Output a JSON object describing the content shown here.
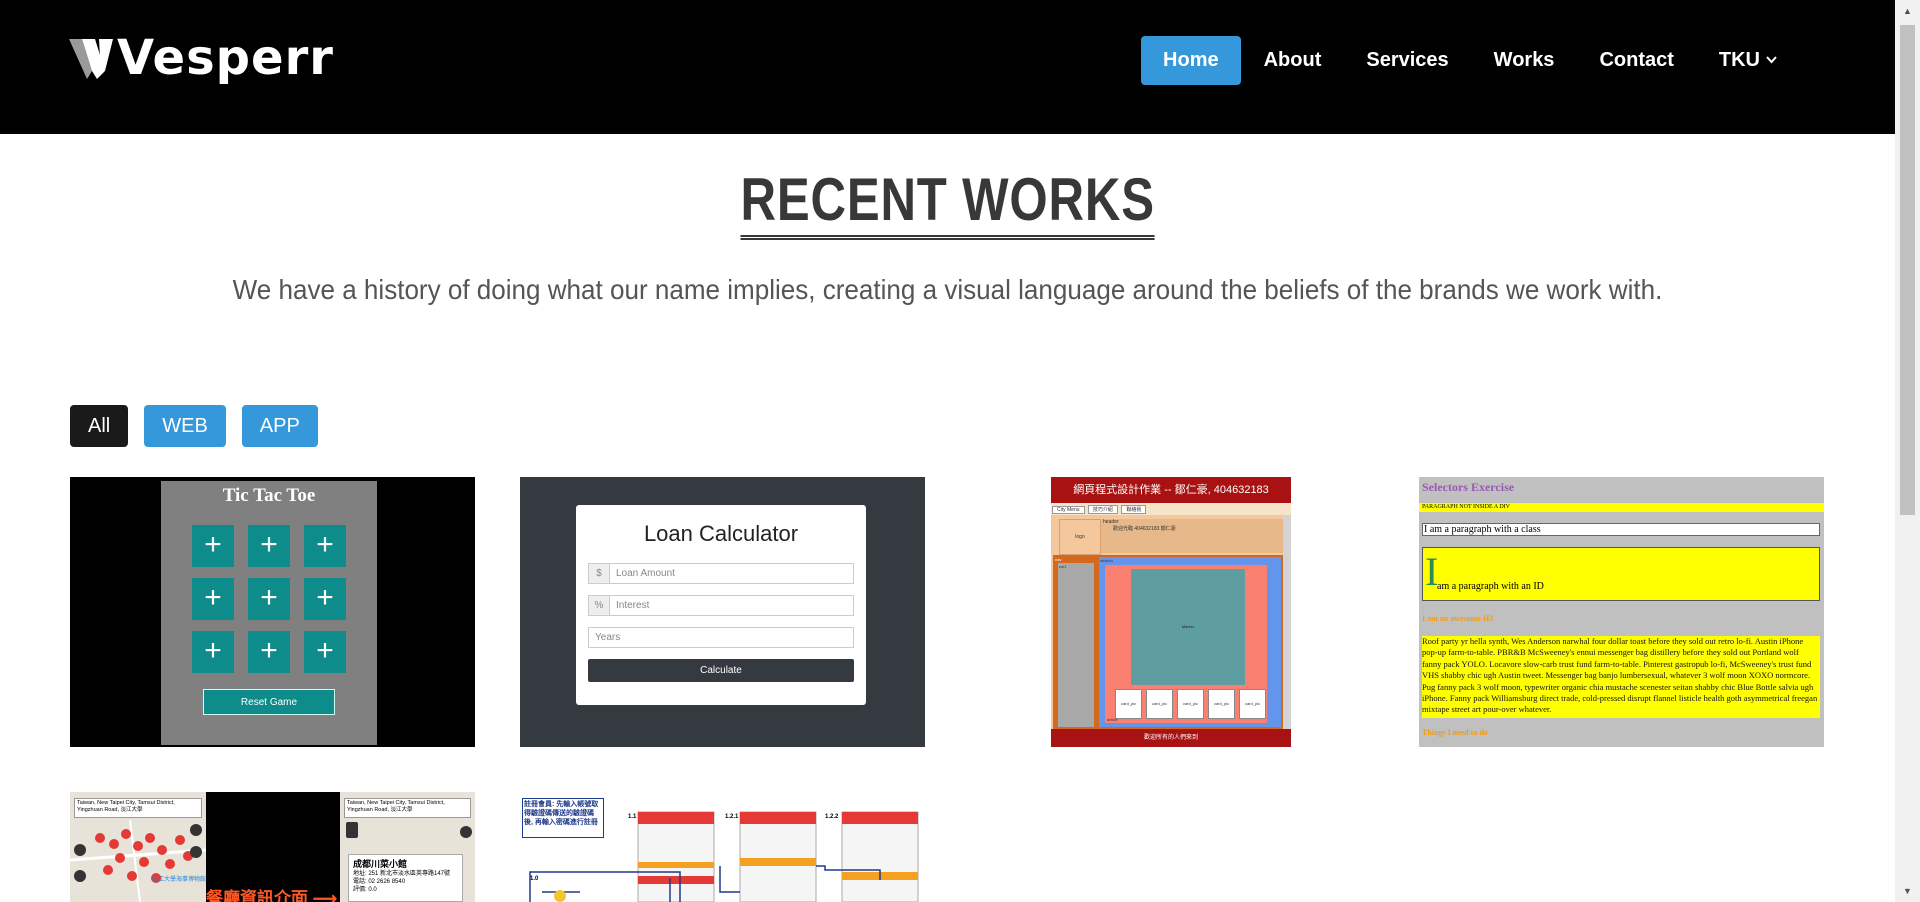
{
  "header": {
    "logo_text": "Vesperr",
    "nav": [
      {
        "label": "Home",
        "active": true
      },
      {
        "label": "About",
        "active": false
      },
      {
        "label": "Services",
        "active": false
      },
      {
        "label": "Works",
        "active": false
      },
      {
        "label": "Contact",
        "active": false
      },
      {
        "label": "TKU",
        "active": false,
        "has_dropdown": true
      }
    ]
  },
  "works": {
    "title": "RECENT WORKS",
    "subtitle": "We have a history of doing what our name implies, creating a visual language around the beliefs of the brands we work with.",
    "filters": [
      {
        "label": "All",
        "active": true
      },
      {
        "label": "WEB",
        "active": false
      },
      {
        "label": "APP",
        "active": false
      }
    ]
  },
  "cards": {
    "tictactoe": {
      "title": "Tic Tac Toe",
      "cell_symbol": "+",
      "reset_label": "Reset Game"
    },
    "loan": {
      "title": "Loan Calculator",
      "amount_addon": "$",
      "amount_placeholder": "Loan Amount",
      "interest_addon": "%",
      "interest_placeholder": "Interest",
      "years_placeholder": "Years",
      "button": "Calculate"
    },
    "layout_hw": {
      "title": "網頁程式設計作業 -- 鄒仁豪, 404632183",
      "tabs": [
        "City Menu",
        "技巧介紹",
        "聯絡我"
      ],
      "logo": "logo",
      "header": "header",
      "header_text": "歡迎光臨 404632183 鄒仁豪",
      "nav": "nav",
      "col1": "col1",
      "section": "section",
      "main": "Marker",
      "pics": [
        "card_pic",
        "card_pic",
        "card_pic",
        "card_pic",
        "card_pic"
      ],
      "article": "article",
      "footer": "歡迎所有的人們來到"
    },
    "selectors": {
      "title": "Selectors Exercise",
      "p1": "PARAGRAPH NOT INSIDE A DIV",
      "p2": "I am a paragraph with a class",
      "p3_cap": "I",
      "p3_rest": "am a paragraph with an ID",
      "h3": "I am an awesome H3",
      "lorem": "Roof party yr hella synth, Wes Anderson narwhal four dollar toast before they sold out retro lo-fi. Austin iPhone pop-up farm-to-table. PBR&B McSweeney's ennui messenger bag distillery before they sold out Portland wolf fanny pack YOLO. Locavore slow-carb trust fund farm-to-table. Pinterest gastropub lo-fi, McSweeney's trust fund VHS shabby chic ugh Austin tweet. Messenger bag banjo lumbersexual, whatever 3 wolf moon XOXO normcore. Pug fanny pack 3 wolf moon, typewriter organic chia mustache scenester seitan shabby chic Blue Bottle salvia ugh iPhone. Fanny pack Williamsburg direct trade, cold-pressed disrupt flannel listicle health goth asymmetrical freegan mixtape street art pour-over whatever.",
      "h4": "Things I need to do"
    },
    "map_app": {
      "search_left": "Taiwan, New Taipei City, Tamsui District, Yingzhuan Road, 淡江大學",
      "search_right": "Taiwan, New Taipei City, Tamsui District, Yingzhuan Road, 淡江大學",
      "campus_label": "淡江大學海事博物館",
      "banner": "餐廳資訊介面",
      "info_name": "成都川菜小館",
      "info_addr": "地址: 251 新北市淡水區英專路147號",
      "info_phone": "電話: 02 2626 8540",
      "info_rating": "評價: 0.0"
    },
    "flow_app": {
      "note": "註冊會員: 先輸入帳號取得驗證碼傳送的驗證碼後, 再輸入密碼進行註冊",
      "step1": "1.1",
      "step2": "1.2.1",
      "step3": "1.2.2",
      "step4": "1.0"
    }
  },
  "colors": {
    "accent": "#3498db",
    "header_bg": "#000000",
    "title": "#383838"
  }
}
